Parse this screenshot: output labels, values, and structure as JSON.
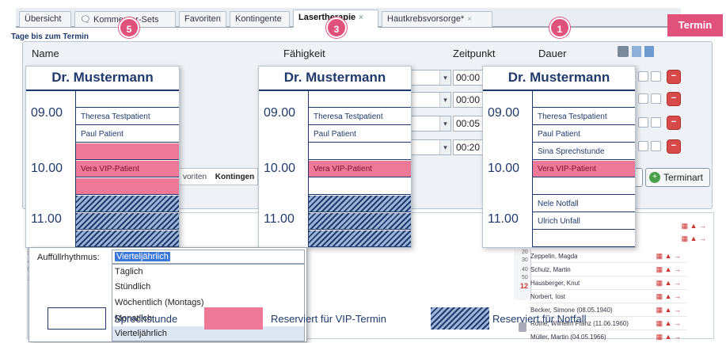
{
  "tabs": [
    {
      "label": "Übersicht"
    },
    {
      "label": "Kommentar-Sets"
    },
    {
      "label": "Favoriten"
    },
    {
      "label": "Kontingente"
    },
    {
      "label": "Lasertherapie",
      "close": "×"
    },
    {
      "label": "Hautkrebsvorsorge*",
      "close": "×"
    }
  ],
  "termin_button": "Termin",
  "badges": [
    "5",
    "3",
    "1"
  ],
  "tage_label": "Tage bis zum Termin",
  "columns": {
    "name": "Name",
    "faehigkeit": "Fähigkeit",
    "zeitpunkt": "Zeitpunkt",
    "dauer": "Dauer"
  },
  "time_values": [
    "00:00",
    "00:00",
    "00:05",
    "00:20"
  ],
  "combo_arrow": "▾",
  "delete_glyph": "−",
  "day_columns": [
    {
      "doctor": "Dr. Mustermann",
      "hours": [
        "09.00",
        "10.00",
        "11.00"
      ],
      "slots": [
        {
          "text": "",
          "type": "free"
        },
        {
          "text": "Theresa Testpatient",
          "type": "free"
        },
        {
          "text": "Paul Patient",
          "type": "free"
        },
        {
          "text": "",
          "type": "vip"
        },
        {
          "text": "Vera VIP-Patient",
          "type": "vip"
        },
        {
          "text": "",
          "type": "vip"
        },
        {
          "text": "",
          "type": "hatch"
        },
        {
          "text": "",
          "type": "hatch"
        },
        {
          "text": "",
          "type": "hatch"
        }
      ]
    },
    {
      "doctor": "Dr. Mustermann",
      "hours": [
        "09.00",
        "10.00",
        "11.00"
      ],
      "slots": [
        {
          "text": "",
          "type": "free"
        },
        {
          "text": "Theresa Testpatient",
          "type": "free"
        },
        {
          "text": "Paul Patient",
          "type": "free"
        },
        {
          "text": "",
          "type": "free"
        },
        {
          "text": "Vera VIP-Patient",
          "type": "vip"
        },
        {
          "text": "",
          "type": "free"
        },
        {
          "text": "",
          "type": "hatch"
        },
        {
          "text": "",
          "type": "hatch"
        },
        {
          "text": "",
          "type": "hatch"
        }
      ]
    },
    {
      "doctor": "Dr. Mustermann",
      "hours": [
        "09.00",
        "10.00",
        "11.00"
      ],
      "slots": [
        {
          "text": "",
          "type": "free"
        },
        {
          "text": "Theresa Testpatient",
          "type": "free"
        },
        {
          "text": "Paul Patient",
          "type": "free"
        },
        {
          "text": "Sina Sprechstunde",
          "type": "free"
        },
        {
          "text": "Vera VIP-Patient",
          "type": "vip"
        },
        {
          "text": "",
          "type": "free"
        },
        {
          "text": "Nele Notfall",
          "type": "free"
        },
        {
          "text": "Ulrich Unfall",
          "type": "free"
        },
        {
          "text": "",
          "type": "free"
        }
      ]
    }
  ],
  "hidden_tabs": {
    "favoriten": "voriten",
    "kontingente": "Kontingen"
  },
  "terminart_button": "Terminart",
  "dropdown": {
    "label": "Auffüllrhythmus:",
    "selected": "Vierteljährlich",
    "options": [
      "Täglich",
      "Stündlich",
      "Wöchentlich (Montags)",
      "Monatlich",
      "Vierteljährlich"
    ]
  },
  "legend": {
    "sprechstunde": "Sprechstunde",
    "vip": "Reserviert für VIP-Termin",
    "notfall": "Reserviert für Notfall"
  },
  "bg_hours": [
    "40",
    "50",
    "11",
    "10",
    "20",
    "30",
    "40",
    "50",
    "12"
  ],
  "bg_hours_right": [
    "20",
    "30",
    "40",
    "50",
    "12"
  ],
  "patients": [
    "Zeppelin, Magda",
    "Schulz, Martin",
    "Hausberger, Knut",
    "Norbert, Iost",
    "Becker, Simone (08.05.1940)",
    "Rothe, Wilhelm Franz (11.06.1960)",
    "Müller, Martin (04.05.1966)"
  ],
  "colors": {
    "accent": "#e0527c",
    "navy": "#1f3a6b",
    "vip": "#ee7898"
  }
}
